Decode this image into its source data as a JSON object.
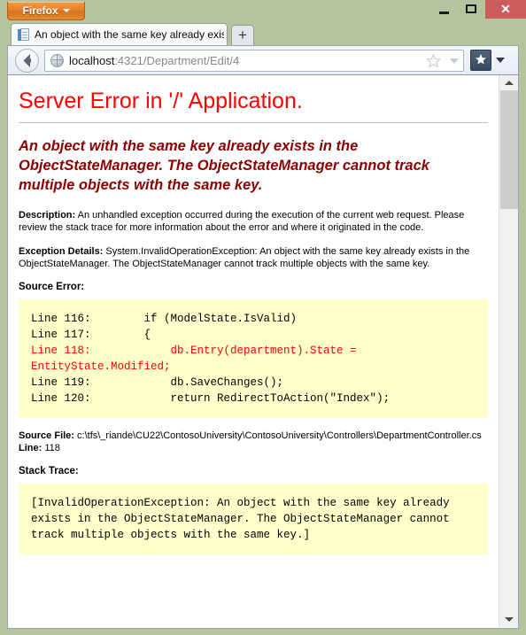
{
  "titlebar": {
    "app_button_label": "Firefox",
    "minimize_label": "Minimize",
    "maximize_label": "Maximize",
    "close_label": "✕"
  },
  "tabs": {
    "active_tab_title": "An object with the same key already exis...",
    "new_tab_label": "+"
  },
  "navbar": {
    "url_host": "localhost",
    "url_rest": ":4321/Department/Edit/4",
    "full_url": "localhost:4321/Department/Edit/4"
  },
  "page": {
    "title": "Server Error in '/' Application.",
    "exception_message": "An object with the same key already exists in the ObjectStateManager. The ObjectStateManager cannot track multiple objects with the same key.",
    "description_label": "Description:",
    "description_text": " An unhandled exception occurred during the execution of the current web request. Please review the stack trace for more information about the error and where it originated in the code.",
    "exception_details_label": "Exception Details:",
    "exception_details_text": " System.InvalidOperationException: An object with the same key already exists in the ObjectStateManager. The ObjectStateManager cannot track multiple objects with the same key.",
    "source_error_label": "Source Error:",
    "source_code_before": "Line 116:        if (ModelState.IsValid)\nLine 117:        {\n",
    "source_code_highlight": "Line 118:            db.Entry(department).State = EntityState.Modified;",
    "source_code_after": "\nLine 119:            db.SaveChanges();\nLine 120:            return RedirectToAction(\"Index\");",
    "source_file_label": "Source File:",
    "source_file_value": " c:\\tfs\\_riande\\CU22\\ContosoUniversity\\ContosoUniversity\\Controllers\\DepartmentController.cs",
    "line_label": "Line:",
    "line_value": " 118",
    "stack_trace_label": "Stack Trace:",
    "stack_trace_text": "[InvalidOperationException: An object with the same key already exists in the ObjectStateManager. The ObjectStateManager cannot track multiple objects with the same key.]"
  },
  "colors": {
    "title_red": "#ff0000",
    "exception_dark_red": "#8b0000",
    "code_background": "#ffffcc",
    "chrome_green": "#b3c49e",
    "firefox_orange": "#e5832c",
    "close_red": "#cd5c5c"
  }
}
